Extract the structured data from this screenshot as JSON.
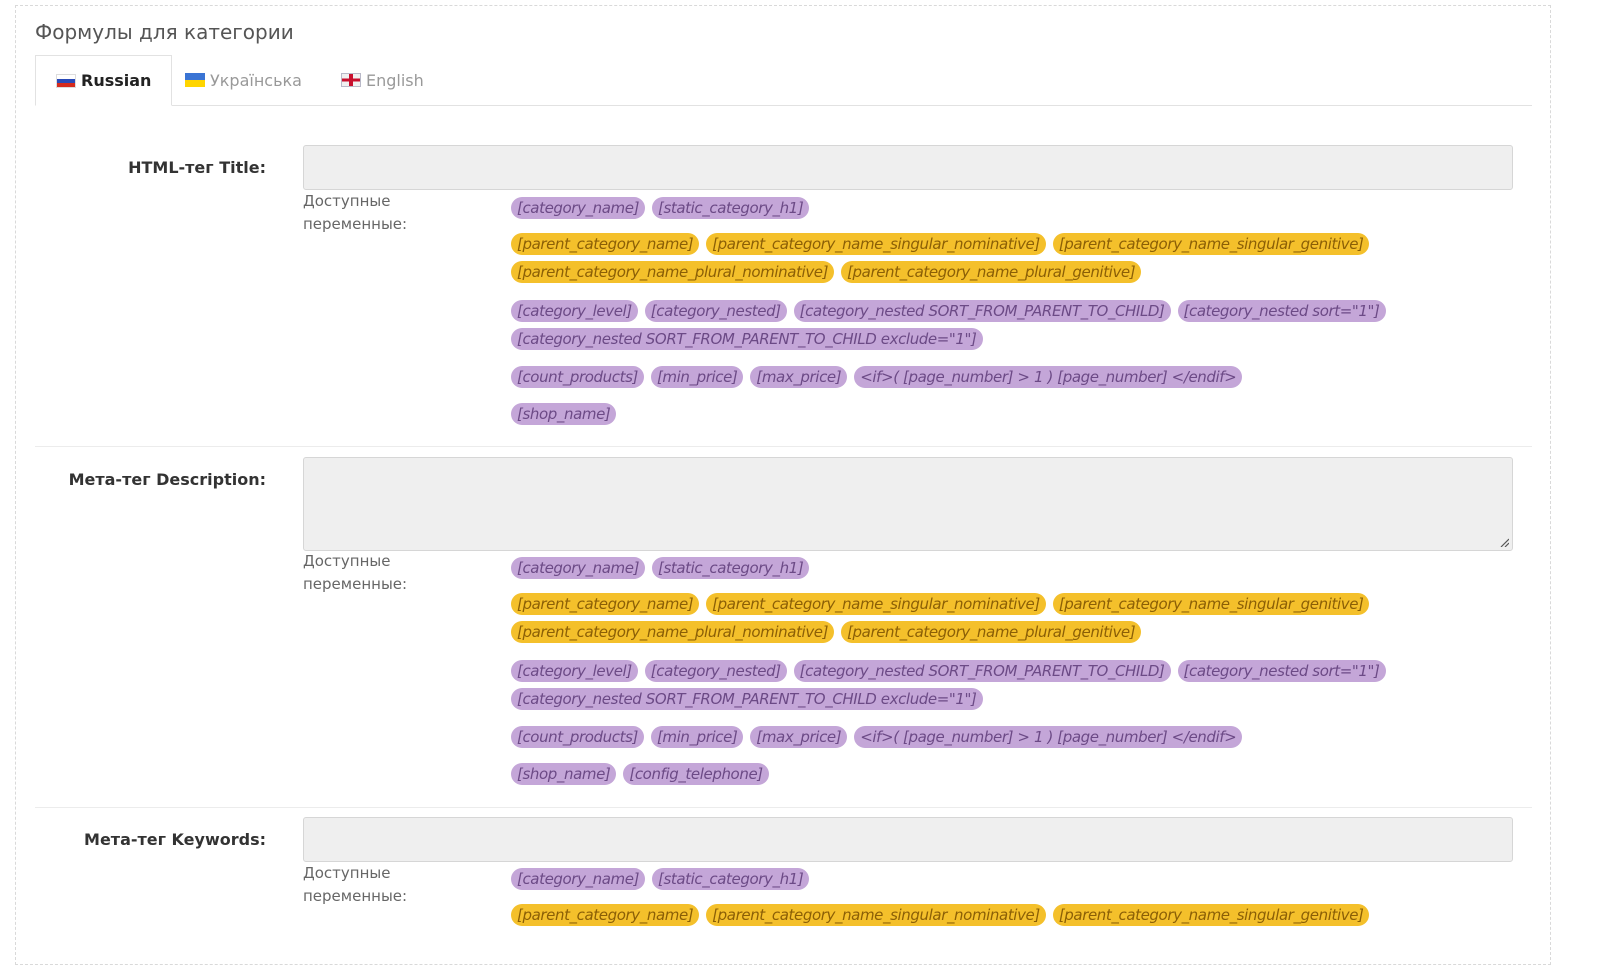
{
  "panel": {
    "title": "Формулы для категории"
  },
  "tabs": [
    {
      "label": "Russian",
      "icon": "flag-russia-icon"
    },
    {
      "label": "Українська",
      "icon": "flag-ukraine-icon"
    },
    {
      "label": "English",
      "icon": "flag-uk-icon"
    }
  ],
  "vars_label": "Доступные переменные:",
  "fields": {
    "title": {
      "label": "HTML-тег Title:",
      "value": "",
      "groups": [
        {
          "color": "purple",
          "items": [
            "[category_name]",
            "[static_category_h1]"
          ]
        },
        {
          "color": "yellow",
          "items": [
            "[parent_category_name]",
            "[parent_category_name_singular_nominative]",
            "[parent_category_name_singular_genitive]",
            "[parent_category_name_plural_nominative]",
            "[parent_category_name_plural_genitive]"
          ]
        },
        {
          "color": "purple",
          "items": [
            "[category_level]",
            "[category_nested]",
            "[category_nested SORT_FROM_PARENT_TO_CHILD]",
            "[category_nested sort=\"1\"]",
            "[category_nested SORT_FROM_PARENT_TO_CHILD exclude=\"1\"]"
          ]
        },
        {
          "color": "purple",
          "items": [
            "[count_products]",
            "[min_price]",
            "[max_price]",
            "<if>( [page_number] > 1 ) [page_number] </endif>"
          ]
        },
        {
          "color": "purple",
          "items": [
            "[shop_name]"
          ]
        }
      ]
    },
    "description": {
      "label": "Мета-тег Description:",
      "value": "",
      "groups": [
        {
          "color": "purple",
          "items": [
            "[category_name]",
            "[static_category_h1]"
          ]
        },
        {
          "color": "yellow",
          "items": [
            "[parent_category_name]",
            "[parent_category_name_singular_nominative]",
            "[parent_category_name_singular_genitive]",
            "[parent_category_name_plural_nominative]",
            "[parent_category_name_plural_genitive]"
          ]
        },
        {
          "color": "purple",
          "items": [
            "[category_level]",
            "[category_nested]",
            "[category_nested SORT_FROM_PARENT_TO_CHILD]",
            "[category_nested sort=\"1\"]",
            "[category_nested SORT_FROM_PARENT_TO_CHILD exclude=\"1\"]"
          ]
        },
        {
          "color": "purple",
          "items": [
            "[count_products]",
            "[min_price]",
            "[max_price]",
            "<if>( [page_number] > 1 ) [page_number] </endif>"
          ]
        },
        {
          "color": "purple",
          "items": [
            "[shop_name]",
            "[config_telephone]"
          ]
        }
      ]
    },
    "keywords": {
      "label": "Мета-тег Keywords:",
      "value": "",
      "groups": [
        {
          "color": "purple",
          "items": [
            "[category_name]",
            "[static_category_h1]"
          ]
        },
        {
          "color": "yellow",
          "items": [
            "[parent_category_name]",
            "[parent_category_name_singular_nominative]",
            "[parent_category_name_singular_genitive]"
          ]
        }
      ]
    }
  },
  "colors": {
    "chip_purple": "#c4a6d8",
    "chip_yellow": "#f4c02b",
    "input_bg": "#efefef"
  }
}
